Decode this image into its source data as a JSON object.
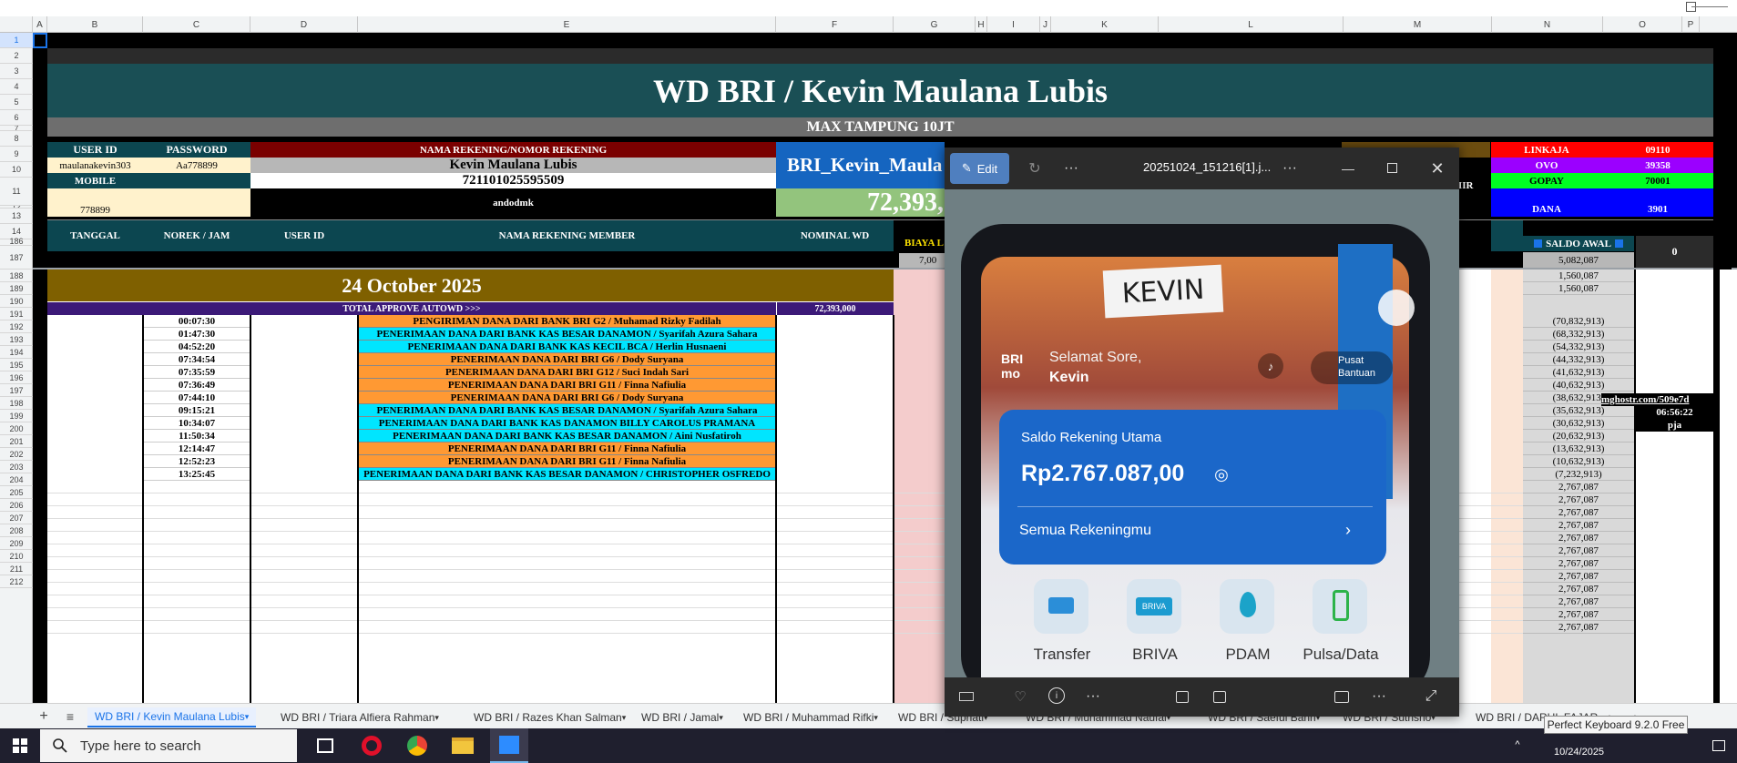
{
  "columns": [
    "A",
    "B",
    "C",
    "D",
    "E",
    "F",
    "G",
    "H",
    "I",
    "J",
    "K",
    "L",
    "M",
    "N",
    "O",
    "P"
  ],
  "rows_top": [
    "1",
    "2",
    "3",
    "4",
    "5",
    "6",
    "7",
    "8",
    "9",
    "10",
    "11",
    "12",
    "13",
    "14"
  ],
  "rows_body": [
    "186",
    "187",
    "188",
    "189",
    "190",
    "191",
    "192",
    "193",
    "194",
    "195",
    "196",
    "197",
    "198",
    "199",
    "200",
    "201",
    "202",
    "203",
    "204",
    "205",
    "206",
    "207",
    "208",
    "209",
    "210",
    "211",
    "212"
  ],
  "sheet": {
    "title": "WD BRI / Kevin Maulana Lubis",
    "subtitle": "MAX TAMPUNG 10JT",
    "info": {
      "user_id_label": "USER ID",
      "password_label": "PASSWORD",
      "user_id": "maulanakevin303",
      "password": "Aa778899",
      "mobile_label": "MOBILE",
      "mobile": "778899",
      "nama_label": "NAMA REKENING/NOMOR REKENING",
      "nama": "Kevin Maulana Lubis",
      "nomor": "721101025595509",
      "extra": "andodmk",
      "bank_label": "BRI_Kevin_Maula",
      "total_big": "72,393,",
      "ahir_partial": "IIR"
    },
    "ewallets": [
      {
        "name": "LINKAJA",
        "value": "09110",
        "color": "#ff0000"
      },
      {
        "name": "OVO",
        "value": "39358",
        "color": "#9b00ff"
      },
      {
        "name": "GOPAY",
        "value": "70001",
        "color": "#00ff22"
      },
      {
        "name": "DANA",
        "value": "3901",
        "color": "#0000ff"
      }
    ],
    "headers": {
      "tanggal": "TANGGAL",
      "norek": "NOREK / JAM",
      "userid": "USER ID",
      "nama": "NAMA REKENING MEMBER",
      "nominal": "NOMINAL WD",
      "biaya": "BIAYA L",
      "biaya_val": "7,00",
      "saldo_awal": "SALDO AWAL",
      "saldo_awal_val": "5,082,087",
      "zero": "0"
    },
    "date_banner": "24 October 2025",
    "total_label": "TOTAL APPROVE AUTOWD >>>",
    "total_value": "72,393,000",
    "saldo_top": [
      "1,560,087",
      "1,560,087"
    ],
    "transactions": [
      {
        "time": "00:07:30",
        "desc": "PENGIRIMAN DANA DARI BANK BRI G2 / Muhamad Rizky Fadilah",
        "color": "#ff9933",
        "saldo": "(70,832,913)"
      },
      {
        "time": "01:47:30",
        "desc": "PENERIMAAN DANA DARI BANK KAS BESAR DANAMON / Syarifah Azura Sahara",
        "color": "#00e5ff",
        "saldo": "(68,332,913)"
      },
      {
        "time": "04:52:20",
        "desc": "PENERIMAAN DANA DARI BANK KAS KECIL BCA / Herlin Husnaeni",
        "color": "#00e5ff",
        "saldo": "(54,332,913)"
      },
      {
        "time": "07:34:54",
        "desc": "PENERIMAAN DANA DARI BRI G6 / Dody Suryana",
        "color": "#ff9933",
        "saldo": "(44,332,913)"
      },
      {
        "time": "07:35:59",
        "desc": "PENERIMAAN DANA DARI BRI G12 / Suci Indah Sari",
        "color": "#ff9933",
        "saldo": "(41,632,913)"
      },
      {
        "time": "07:36:49",
        "desc": "PENERIMAAN DANA DARI BRI G11 / Finna Nafiulia",
        "color": "#ff9933",
        "saldo": "(40,632,913)"
      },
      {
        "time": "07:44:10",
        "desc": "PENERIMAAN DANA DARI BRI G6 / Dody Suryana",
        "color": "#ff9933",
        "saldo": "(38,632,913)"
      },
      {
        "time": "09:15:21",
        "desc": "PENERIMAAN DANA DARI BANK KAS BESAR DANAMON / Syarifah Azura Sahara",
        "color": "#00e5ff",
        "saldo": "(35,632,913)"
      },
      {
        "time": "10:34:07",
        "desc": "PENERIMAAN DANA DARI BANK KAS DANAMON BILLY CAROLUS PRAMANA",
        "color": "#00e5ff",
        "saldo": "(30,632,913)"
      },
      {
        "time": "11:50:34",
        "desc": "PENERIMAAN DANA DARI BANK KAS BESAR DANAMON / Aini Nusfatiroh",
        "color": "#00e5ff",
        "saldo": "(20,632,913)"
      },
      {
        "time": "12:14:47",
        "desc": "PENERIMAAN DANA DARI BRI G11 / Finna Nafiulia",
        "color": "#ff9933",
        "saldo": "(13,632,913)"
      },
      {
        "time": "12:52:23",
        "desc": "PENERIMAAN DANA DARI BRI G11 / Finna Nafiulia",
        "color": "#ff9933",
        "saldo": "(10,632,913)"
      },
      {
        "time": "13:25:45",
        "desc": "PENERIMAAN DANA DARI BANK KAS BESAR DANAMON / CHRISTOPHER OSFREDO",
        "color": "#00e5ff",
        "saldo": "(7,232,913)"
      }
    ],
    "saldo_tail": [
      "2,767,087",
      "2,767,087",
      "2,767,087",
      "2,767,087",
      "2,767,087",
      "2,767,087",
      "2,767,087",
      "2,767,087",
      "2,767,087",
      "2,767,087",
      "2,767,087",
      "2,767,087"
    ],
    "side_notes": [
      "mghostr.com/509e7d",
      "06:56:22",
      "pja"
    ]
  },
  "tabs": [
    "WD BRI / Kevin Maulana Lubis",
    "WD BRI / Triara Alfiera Rahman",
    "WD BRI / Razes Khan Salman",
    "WD BRI / Jamal",
    "WD BRI / Muhammad Rifki",
    "WD BRI / Supriati",
    "WD BRI / Muhammad Naufal",
    "WD BRI / Saeful Bahri",
    "WD BRI / Sutrisno",
    "WD BRI / DARUL FAJAR"
  ],
  "viewer": {
    "edit_label": "Edit",
    "filename": "20251024_151216[1].j...",
    "phone": {
      "sticker": "KEVIN",
      "greeting": "Selamat Sore,",
      "name": "Kevin",
      "help": "Pusat Bantuan",
      "card_title": "Saldo Rekening Utama",
      "balance": "Rp2.767.087,00",
      "accounts": "Semua Rekeningmu",
      "menu": [
        "Transfer",
        "BRIVA",
        "PDAM",
        "Pulsa/Data"
      ]
    }
  },
  "taskbar": {
    "search_placeholder": "Type here to search",
    "tooltip": "Perfect Keyboard 9.2.0 Free",
    "date": "10/24/2025"
  }
}
